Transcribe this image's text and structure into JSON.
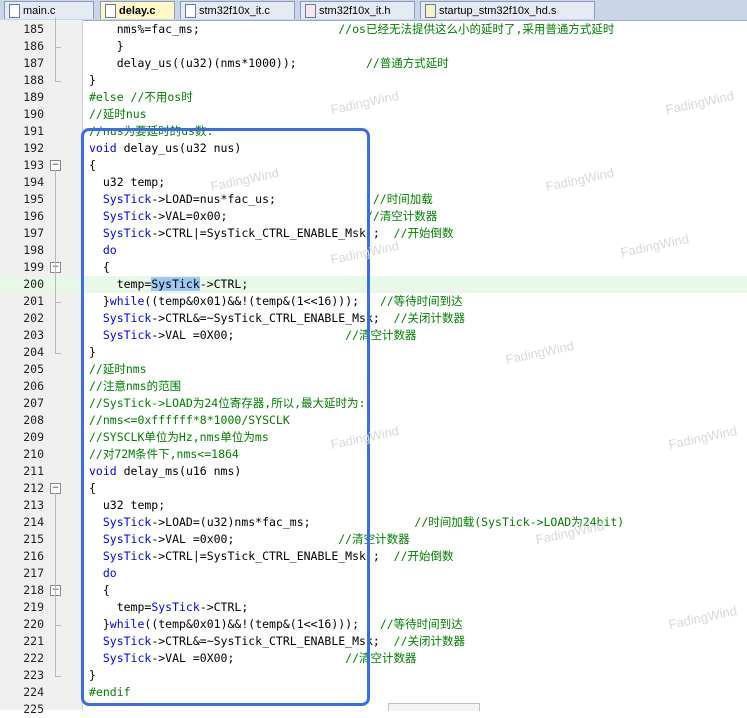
{
  "tabs": [
    {
      "label": "main.c",
      "active": false,
      "icon": "file-c-icon"
    },
    {
      "label": "delay.c",
      "active": true,
      "icon": "file-c-icon"
    },
    {
      "label": "stm32f10x_it.c",
      "active": false,
      "icon": "file-c-icon"
    },
    {
      "label": "stm32f10x_it.h",
      "active": false,
      "icon": "file-h-icon"
    },
    {
      "label": "startup_stm32f10x_hd.s",
      "active": false,
      "icon": "file-s-icon"
    }
  ],
  "watermark": "FadingWind",
  "colors": {
    "keyword": "#0000ee",
    "comment": "#008000",
    "selection": "#9ec7f5",
    "highlight_box": "#3a6ee8",
    "current_line": "#e8f8e8"
  },
  "lines": [
    {
      "n": "185",
      "parts": [
        [
          "",
          "    nms%=fac_ms;"
        ],
        [
          "cm",
          "                    //os已经无法提供这么小的延时了,采用普通方式延时"
        ]
      ]
    },
    {
      "n": "186",
      "parts": [
        [
          "",
          "    }"
        ]
      ]
    },
    {
      "n": "187",
      "parts": [
        [
          "",
          "    delay_us((u32)(nms*1000));"
        ],
        [
          "cm",
          "          //普通方式延时"
        ]
      ]
    },
    {
      "n": "188",
      "parts": [
        [
          "",
          "}"
        ]
      ]
    },
    {
      "n": "189",
      "parts": [
        [
          "cm",
          "#else //不用os时"
        ]
      ]
    },
    {
      "n": "190",
      "parts": [
        [
          "cm",
          "//延时nus"
        ]
      ]
    },
    {
      "n": "191",
      "parts": [
        [
          "cm",
          "//nus为要延时的us数."
        ]
      ]
    },
    {
      "n": "192",
      "parts": [
        [
          "kw",
          "void"
        ],
        [
          "",
          " delay_us(u32 nus)"
        ]
      ]
    },
    {
      "n": "193",
      "parts": [
        [
          "",
          "{"
        ]
      ]
    },
    {
      "n": "194",
      "parts": [
        [
          "",
          "  u32 temp;"
        ]
      ]
    },
    {
      "n": "195",
      "parts": [
        [
          "kw",
          "  SysTick"
        ],
        [
          "",
          "->LOAD=nus*fac_us;"
        ],
        [
          "cm",
          "              //时间加载"
        ]
      ]
    },
    {
      "n": "196",
      "parts": [
        [
          "kw",
          "  SysTick"
        ],
        [
          "",
          "->VAL=0x00;"
        ],
        [
          "cm",
          "                    //清空计数器"
        ]
      ]
    },
    {
      "n": "197",
      "parts": [
        [
          "kw",
          "  SysTick"
        ],
        [
          "",
          "->CTRL|=SysTick_CTRL_ENABLE_Msk ; "
        ],
        [
          "cm",
          " //开始倒数"
        ]
      ]
    },
    {
      "n": "198",
      "parts": [
        [
          "kw",
          "  do"
        ]
      ]
    },
    {
      "n": "199",
      "parts": [
        [
          "",
          "  {"
        ]
      ]
    },
    {
      "n": "200",
      "parts": [
        [
          "",
          "    temp="
        ],
        [
          "sel",
          "SysTick"
        ],
        [
          "",
          "->CTRL;"
        ]
      ]
    },
    {
      "n": "201",
      "parts": [
        [
          "",
          "  }"
        ],
        [
          "kw",
          "while"
        ],
        [
          "",
          "((temp&0x01)&&!(temp&(1<<16)));  "
        ],
        [
          "cm",
          " //等待时间到达"
        ]
      ]
    },
    {
      "n": "202",
      "parts": [
        [
          "kw",
          "  SysTick"
        ],
        [
          "",
          "->CTRL&=~SysTick_CTRL_ENABLE_Msk; "
        ],
        [
          "cm",
          " //关闭计数器"
        ]
      ]
    },
    {
      "n": "203",
      "parts": [
        [
          "kw",
          "  SysTick"
        ],
        [
          "",
          "->VAL =0X00;"
        ],
        [
          "cm",
          "                //清空计数器"
        ]
      ]
    },
    {
      "n": "204",
      "parts": [
        [
          "",
          "}"
        ]
      ]
    },
    {
      "n": "205",
      "parts": [
        [
          "cm",
          "//延时nms"
        ]
      ]
    },
    {
      "n": "206",
      "parts": [
        [
          "cm",
          "//注意nms的范围"
        ]
      ]
    },
    {
      "n": "207",
      "parts": [
        [
          "cm",
          "//SysTick->LOAD为24位寄存器,所以,最大延时为:"
        ]
      ]
    },
    {
      "n": "208",
      "parts": [
        [
          "cm",
          "//nms<=0xffffff*8*1000/SYSCLK"
        ]
      ]
    },
    {
      "n": "209",
      "parts": [
        [
          "cm",
          "//SYSCLK单位为Hz,nms单位为ms"
        ]
      ]
    },
    {
      "n": "210",
      "parts": [
        [
          "cm",
          "//对72M条件下,nms<=1864"
        ]
      ]
    },
    {
      "n": "211",
      "parts": [
        [
          "kw",
          "void"
        ],
        [
          "",
          " delay_ms(u16 nms)"
        ]
      ]
    },
    {
      "n": "212",
      "parts": [
        [
          "",
          "{"
        ]
      ]
    },
    {
      "n": "213",
      "parts": [
        [
          "",
          "  u32 temp;"
        ]
      ]
    },
    {
      "n": "214",
      "parts": [
        [
          "kw",
          "  SysTick"
        ],
        [
          "",
          "->LOAD=(u32)nms*fac_ms;"
        ],
        [
          "cm",
          "               //时间加载(SysTick->LOAD为24bit)"
        ]
      ]
    },
    {
      "n": "215",
      "parts": [
        [
          "kw",
          "  SysTick"
        ],
        [
          "",
          "->VAL =0x00;"
        ],
        [
          "cm",
          "               //清空计数器"
        ]
      ]
    },
    {
      "n": "216",
      "parts": [
        [
          "kw",
          "  SysTick"
        ],
        [
          "",
          "->CTRL|=SysTick_CTRL_ENABLE_Msk ; "
        ],
        [
          "cm",
          " //开始倒数"
        ]
      ]
    },
    {
      "n": "217",
      "parts": [
        [
          "kw",
          "  do"
        ]
      ]
    },
    {
      "n": "218",
      "parts": [
        [
          "",
          "  {"
        ]
      ]
    },
    {
      "n": "219",
      "parts": [
        [
          "",
          "    temp="
        ],
        [
          "kw",
          "SysTick"
        ],
        [
          "",
          "->CTRL;"
        ]
      ]
    },
    {
      "n": "220",
      "parts": [
        [
          "",
          "  }"
        ],
        [
          "kw",
          "while"
        ],
        [
          "",
          "((temp&0x01)&&!(temp&(1<<16)));  "
        ],
        [
          "cm",
          " //等待时间到达"
        ]
      ]
    },
    {
      "n": "221",
      "parts": [
        [
          "kw",
          "  SysTick"
        ],
        [
          "",
          "->CTRL&=~SysTick_CTRL_ENABLE_Msk; "
        ],
        [
          "cm",
          " //关闭计数器"
        ]
      ]
    },
    {
      "n": "222",
      "parts": [
        [
          "kw",
          "  SysTick"
        ],
        [
          "",
          "->VAL =0X00;"
        ],
        [
          "cm",
          "                //清空计数器"
        ]
      ]
    },
    {
      "n": "223",
      "parts": [
        [
          "",
          "}"
        ]
      ]
    },
    {
      "n": "224",
      "parts": [
        [
          "cm",
          "#endif"
        ]
      ]
    },
    {
      "n": "225",
      "parts": [
        [
          "",
          ""
        ]
      ]
    }
  ]
}
